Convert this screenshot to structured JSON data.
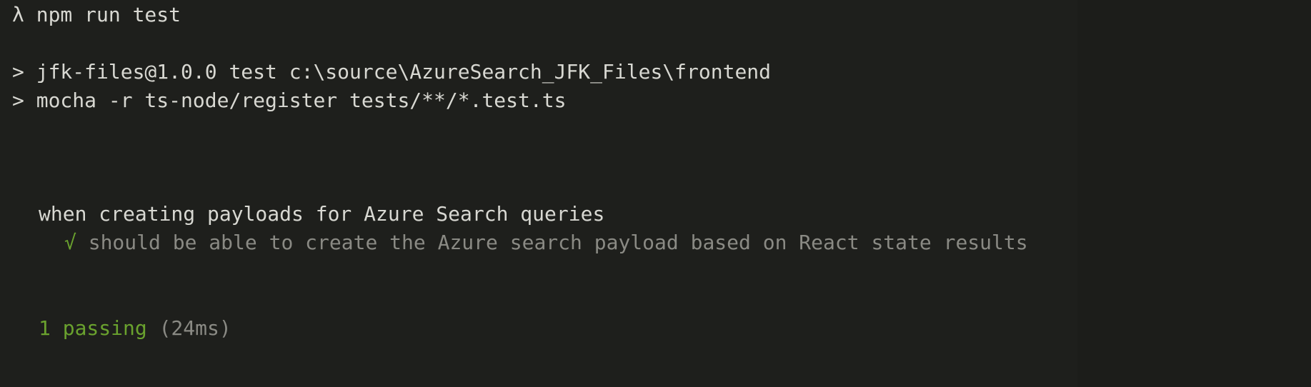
{
  "prompt": {
    "symbol": "λ",
    "command": "npm run test"
  },
  "script_lines": [
    {
      "marker": ">",
      "text": "jfk-files@1.0.0 test c:\\source\\AzureSearch_JFK_Files\\frontend"
    },
    {
      "marker": ">",
      "text": "mocha -r ts-node/register tests/**/*.test.ts"
    }
  ],
  "suite": {
    "title": "when creating payloads for Azure Search queries",
    "tests": [
      {
        "check": "√",
        "title": "should be able to create the Azure search payload based on React state results"
      }
    ]
  },
  "summary": {
    "passing": "1 passing",
    "duration": "(24ms)"
  },
  "colors": {
    "background": "#1e1f1c",
    "text": "#d8d8d2",
    "muted": "#8a8a84",
    "pass": "#6aa22e"
  }
}
